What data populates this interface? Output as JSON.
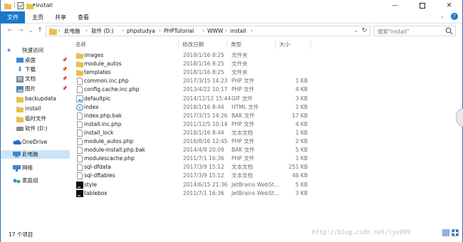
{
  "window": {
    "title": "install"
  },
  "ribbon": {
    "tabs": [
      "文件",
      "主页",
      "共享",
      "查看"
    ]
  },
  "address": {
    "crumbs": [
      "此电脑",
      "软件 (D:)",
      "phpstudya",
      "PHPTutorial",
      "WWW",
      "install"
    ],
    "search_placeholder": "搜索\"install\""
  },
  "nav": {
    "items": [
      {
        "label": "快速访问",
        "icon": "star-icon"
      },
      {
        "label": "桌面",
        "icon": "desktop-icon",
        "pinned": true
      },
      {
        "label": "下载",
        "icon": "download-icon",
        "pinned": true
      },
      {
        "label": "文档",
        "icon": "document-icon",
        "pinned": true
      },
      {
        "label": "图片",
        "icon": "picture-icon",
        "pinned": true
      },
      {
        "label": "backupdata",
        "icon": "folder-icon"
      },
      {
        "label": "install",
        "icon": "folder-icon"
      },
      {
        "label": "临时文件",
        "icon": "folder-icon"
      },
      {
        "label": "软件 (D:)",
        "icon": "drive-icon"
      },
      {
        "label": "OneDrive",
        "icon": "cloud-icon"
      },
      {
        "label": "此电脑",
        "icon": "computer-icon"
      },
      {
        "label": "网络",
        "icon": "network-icon"
      },
      {
        "label": "家庭组",
        "icon": "homegroup-icon"
      }
    ]
  },
  "columns": [
    "名称",
    "修改日期",
    "类型",
    "大小"
  ],
  "files": [
    {
      "name": "images",
      "date": "2018/1/16 8:25",
      "type": "文件夹",
      "size": "",
      "icon": "folder"
    },
    {
      "name": "module_autos",
      "date": "2018/1/16 8:25",
      "type": "文件夹",
      "size": "",
      "icon": "folder"
    },
    {
      "name": "templates",
      "date": "2018/1/16 8:25",
      "type": "文件夹",
      "size": "",
      "icon": "folder"
    },
    {
      "name": "common.inc.php",
      "date": "2017/3/15 14:23",
      "type": "PHP 文件",
      "size": "1 KB",
      "icon": "file"
    },
    {
      "name": "config.cache.inc.php",
      "date": "2013/4/22 10:17",
      "type": "PHP 文件",
      "size": "4 KB",
      "icon": "file"
    },
    {
      "name": "defaultpic",
      "date": "2014/12/12 15:44",
      "type": "GIF 文件",
      "size": "3 KB",
      "icon": "image"
    },
    {
      "name": "index",
      "date": "2018/1/16 8:44",
      "type": "HTML 文件",
      "size": "1 KB",
      "icon": "html"
    },
    {
      "name": "index.php.bak",
      "date": "2017/3/15 14:26",
      "type": "BAK 文件",
      "size": "17 KB",
      "icon": "file"
    },
    {
      "name": "install.inc.php",
      "date": "2011/12/5 10:14",
      "type": "PHP 文件",
      "size": "4 KB",
      "icon": "file"
    },
    {
      "name": "install_lock",
      "date": "2018/1/16 8:44",
      "type": "文本文档",
      "size": "1 KB",
      "icon": "file"
    },
    {
      "name": "module_autos.php",
      "date": "2016/8/16 12:45",
      "type": "PHP 文件",
      "size": "2 KB",
      "icon": "file"
    },
    {
      "name": "module-install.php.bak",
      "date": "2014/4/8 20:09",
      "type": "BAK 文件",
      "size": "5 KB",
      "icon": "file"
    },
    {
      "name": "modulescache.php",
      "date": "2011/7/1 16:36",
      "type": "PHP 文件",
      "size": "1 KB",
      "icon": "file"
    },
    {
      "name": "sql-dfdata",
      "date": "2017/3/9 15:12",
      "type": "文本文档",
      "size": "251 KB",
      "icon": "file"
    },
    {
      "name": "sql-dftables",
      "date": "2017/3/9 15:12",
      "type": "文本文档",
      "size": "46 KB",
      "icon": "file"
    },
    {
      "name": "style",
      "date": "2014/6/15 21:36",
      "type": "JetBrains WebSt...",
      "size": "5 KB",
      "icon": "jetbrains"
    },
    {
      "name": "tablebox",
      "date": "2011/7/1 16:36",
      "type": "JetBrains WebSt...",
      "size": "3 KB",
      "icon": "jetbrains"
    }
  ],
  "status": {
    "count": "17 个项目",
    "watermark": "http://blog.csdn.net/lyx999"
  },
  "colors": {
    "accent": "#1979ca",
    "selection": "#cce4f7",
    "folder": "#e8bf4a"
  }
}
